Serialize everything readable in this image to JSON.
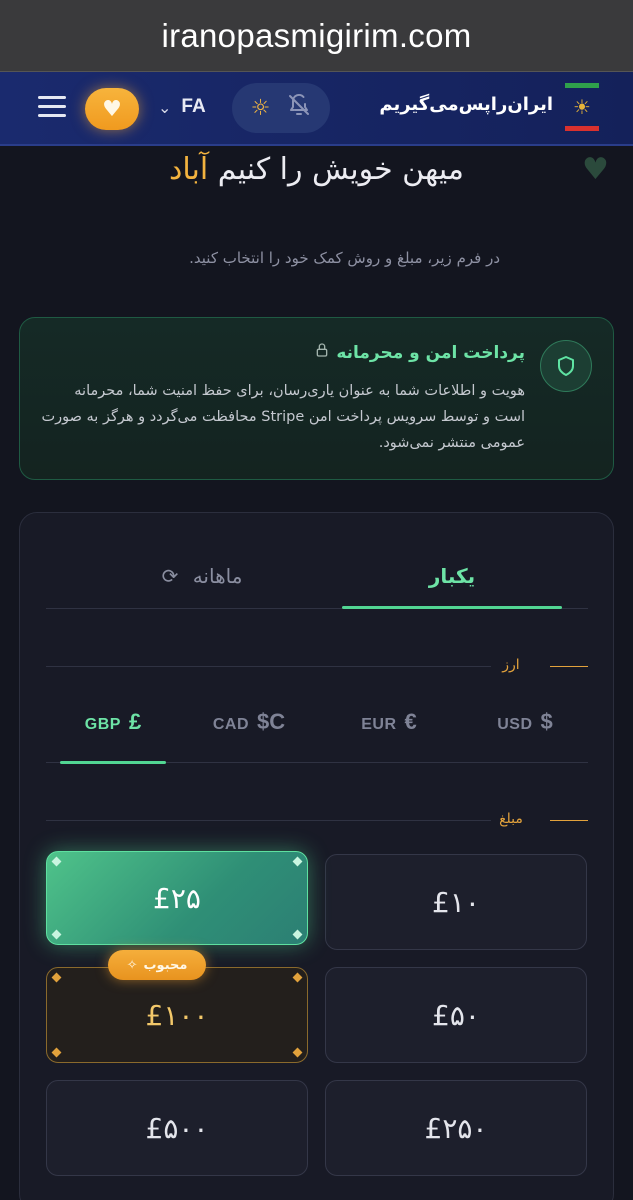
{
  "browser": {
    "url": "iranopasmigirim.com"
  },
  "header": {
    "lang_code": "FA",
    "brand": "ایران‌راپس‌می‌گیریم",
    "icons": {
      "menu": "hamburger-icon",
      "donate": "heart-icon",
      "lang": "chevron-down-icon",
      "theme": "sun-icon",
      "notify": "bell-off-icon",
      "logo": "lion-and-sun-flag-icon"
    }
  },
  "hero": {
    "title_main": "میهن خویش را کنیم",
    "title_accent": "آباد",
    "subtitle": "در فرم زیر، مبلغ و روش کمک خود را انتخاب کنید."
  },
  "secure": {
    "title": "پرداخت امن و محرمانه",
    "body": "هویت و اطلاعات شما به عنوان یاری‌رسان، برای حفظ امنیت شما، محرمانه است و توسط سرویس پرداخت امن Stripe محافظت می‌گردد و هرگز به صورت عمومی منتشر نمی‌شود."
  },
  "tabs": {
    "once": "یکبار",
    "monthly": "ماهانه"
  },
  "currency": {
    "label": "ارز",
    "options": [
      {
        "code": "USD",
        "symbol": "$"
      },
      {
        "code": "EUR",
        "symbol": "€"
      },
      {
        "code": "CAD",
        "symbol": "$C"
      },
      {
        "code": "GBP",
        "symbol": "£"
      }
    ],
    "selected": "GBP"
  },
  "amount": {
    "label": "مبلغ",
    "options": [
      "£۱۰",
      "£۲۵",
      "£۵۰",
      "£۱۰۰",
      "£۲۵۰",
      "£۵۰۰"
    ],
    "selected": "£۲۵",
    "popular_badge": "محبوب"
  },
  "colors": {
    "accent_green": "#52d693",
    "accent_orange": "#f3b33f",
    "header_blue": "#1a2a6e"
  }
}
